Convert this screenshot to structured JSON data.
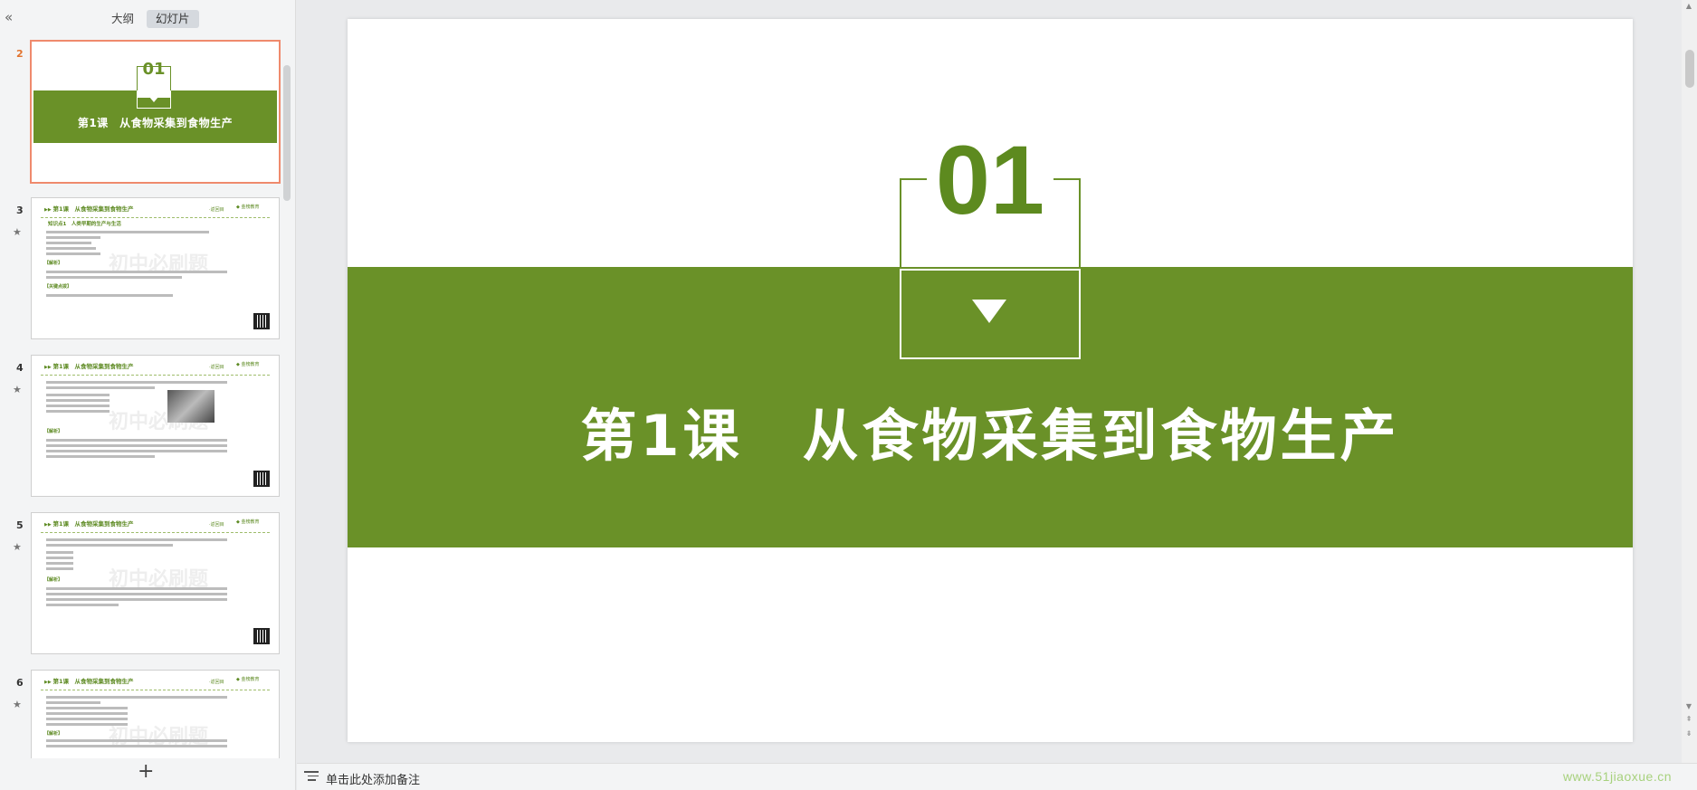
{
  "left_panel": {
    "collapse_icon": "double-chevron-left",
    "tabs": [
      {
        "label": "大纲",
        "active": false
      },
      {
        "label": "幻灯片",
        "active": true
      }
    ],
    "add_label": "+"
  },
  "thumbnails": [
    {
      "number": "2",
      "current": true,
      "big_number": "01",
      "title": "第1课　从食物采集到食物生产"
    },
    {
      "number": "3",
      "star": "★",
      "header": "第1课　从食物采集到食物生产",
      "back": "·返回目",
      "logo": "金榜教育",
      "section": "知识点1　人类早期的生产与生活",
      "analysis": "【解析】",
      "mark": "【关键点拨】",
      "watermark": "初中必刷题"
    },
    {
      "number": "4",
      "star": "★",
      "header": "第1课　从食物采集到食物生产",
      "back": "·返回目",
      "logo": "金榜教育",
      "analysis": "【解析】",
      "watermark": "初中必刷题"
    },
    {
      "number": "5",
      "star": "★",
      "header": "第1课　从食物采集到食物生产",
      "back": "·返回目",
      "logo": "金榜教育",
      "analysis": "【解析】",
      "watermark": "初中必刷题"
    },
    {
      "number": "6",
      "star": "★",
      "header": "第1课　从食物采集到食物生产",
      "back": "·返回目",
      "logo": "金榜教育",
      "analysis": "【解析】",
      "watermark": "初中必刷题"
    }
  ],
  "slide": {
    "number": "01",
    "title": "第1课　从食物采集到食物生产",
    "colors": {
      "accent": "#6a9128",
      "number": "#5d8a1f",
      "background": "#ffffff"
    }
  },
  "notes": {
    "placeholder": "单击此处添加备注",
    "site_watermark": "www.51jiaoxue.cn"
  },
  "scrollbar": {
    "up_icon": "▲",
    "down_icon": "▼",
    "page_up_icon": "⇞",
    "page_down_icon": "⇟"
  }
}
